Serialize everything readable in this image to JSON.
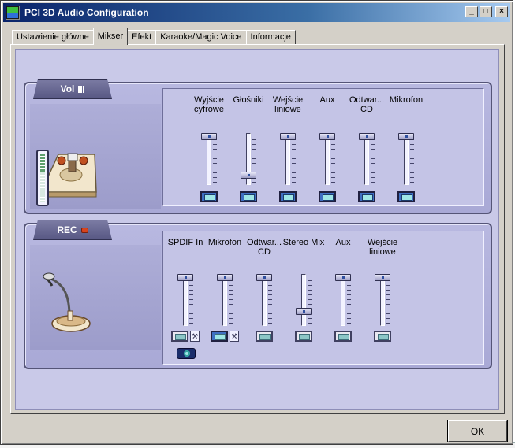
{
  "window": {
    "title": "PCI 3D Audio Configuration",
    "buttons": {
      "minimize": "_",
      "maximize": "□",
      "close": "×"
    }
  },
  "tabs": [
    {
      "label": "Ustawienie główne",
      "active": false
    },
    {
      "label": "Mikser",
      "active": true
    },
    {
      "label": "Efekt",
      "active": false
    },
    {
      "label": "Karaoke/Magic Voice",
      "active": false
    },
    {
      "label": "Informacje",
      "active": false
    }
  ],
  "vol_panel": {
    "label": "Vol",
    "picture": "speaker-stage-icon",
    "channels": [
      {
        "label": "Wyjście cyfrowe",
        "level": 1.0,
        "muted": false
      },
      {
        "label": "Głośniki",
        "level": 0.0,
        "muted": false
      },
      {
        "label": "Wejście liniowe",
        "level": 1.0,
        "muted": false
      },
      {
        "label": "Aux",
        "level": 1.0,
        "muted": false
      },
      {
        "label": "Odtwar... CD",
        "level": 1.0,
        "muted": false
      },
      {
        "label": "Mikrofon",
        "level": 1.0,
        "muted": false
      }
    ],
    "vu_level": 0.38
  },
  "rec_panel": {
    "label": "REC",
    "picture": "microphone-icon",
    "channels": [
      {
        "label": "SPDIF In",
        "level": 1.0,
        "selected": false,
        "has_wrench": true
      },
      {
        "label": "Mikrofon",
        "level": 1.0,
        "selected": true,
        "has_wrench": true
      },
      {
        "label": "Odtwar... CD",
        "level": 1.0,
        "selected": false,
        "has_wrench": false
      },
      {
        "label": "Stereo Mix",
        "level": 0.15,
        "selected": false,
        "has_wrench": false
      },
      {
        "label": "Aux",
        "level": 1.0,
        "selected": false,
        "has_wrench": false
      },
      {
        "label": "Wejście liniowe",
        "level": 1.0,
        "selected": false,
        "has_wrench": false
      }
    ]
  },
  "footer": {
    "ok_label": "OK"
  },
  "colors": {
    "panel": "#b8b8e0",
    "titlebar": "#0a246a",
    "accent": "#3e6fc2"
  }
}
